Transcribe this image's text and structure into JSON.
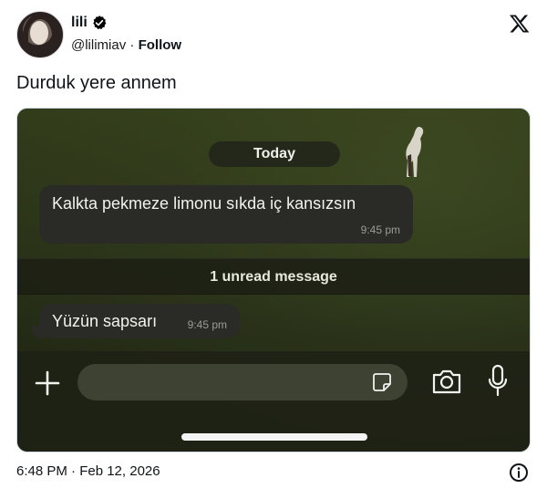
{
  "header": {
    "display_name": "lili",
    "handle": "@lilimiav",
    "separator": "·",
    "follow_label": "Follow"
  },
  "tweet": {
    "text": "Durduk yere annem"
  },
  "chat": {
    "date_pill": "Today",
    "messages": [
      {
        "text": "Kalkta pekmeze limonu sıkda iç kansızsın",
        "time": "9:45 pm"
      },
      {
        "text": "Yüzün sapsarı",
        "time": "9:45 pm"
      }
    ],
    "unread_banner": "1 unread message"
  },
  "footer": {
    "timestamp": "6:48 PM · Feb 12, 2026"
  },
  "icons": {
    "verified": "verified-badge-icon",
    "x_logo": "x-logo-icon",
    "plus": "plus-icon",
    "sticker": "sticker-icon",
    "camera": "camera-icon",
    "mic": "microphone-icon",
    "info": "info-icon"
  },
  "colors": {
    "verified_badge": "#000000",
    "bubble": "#2a2a26",
    "chat_background": "#2a331a"
  }
}
